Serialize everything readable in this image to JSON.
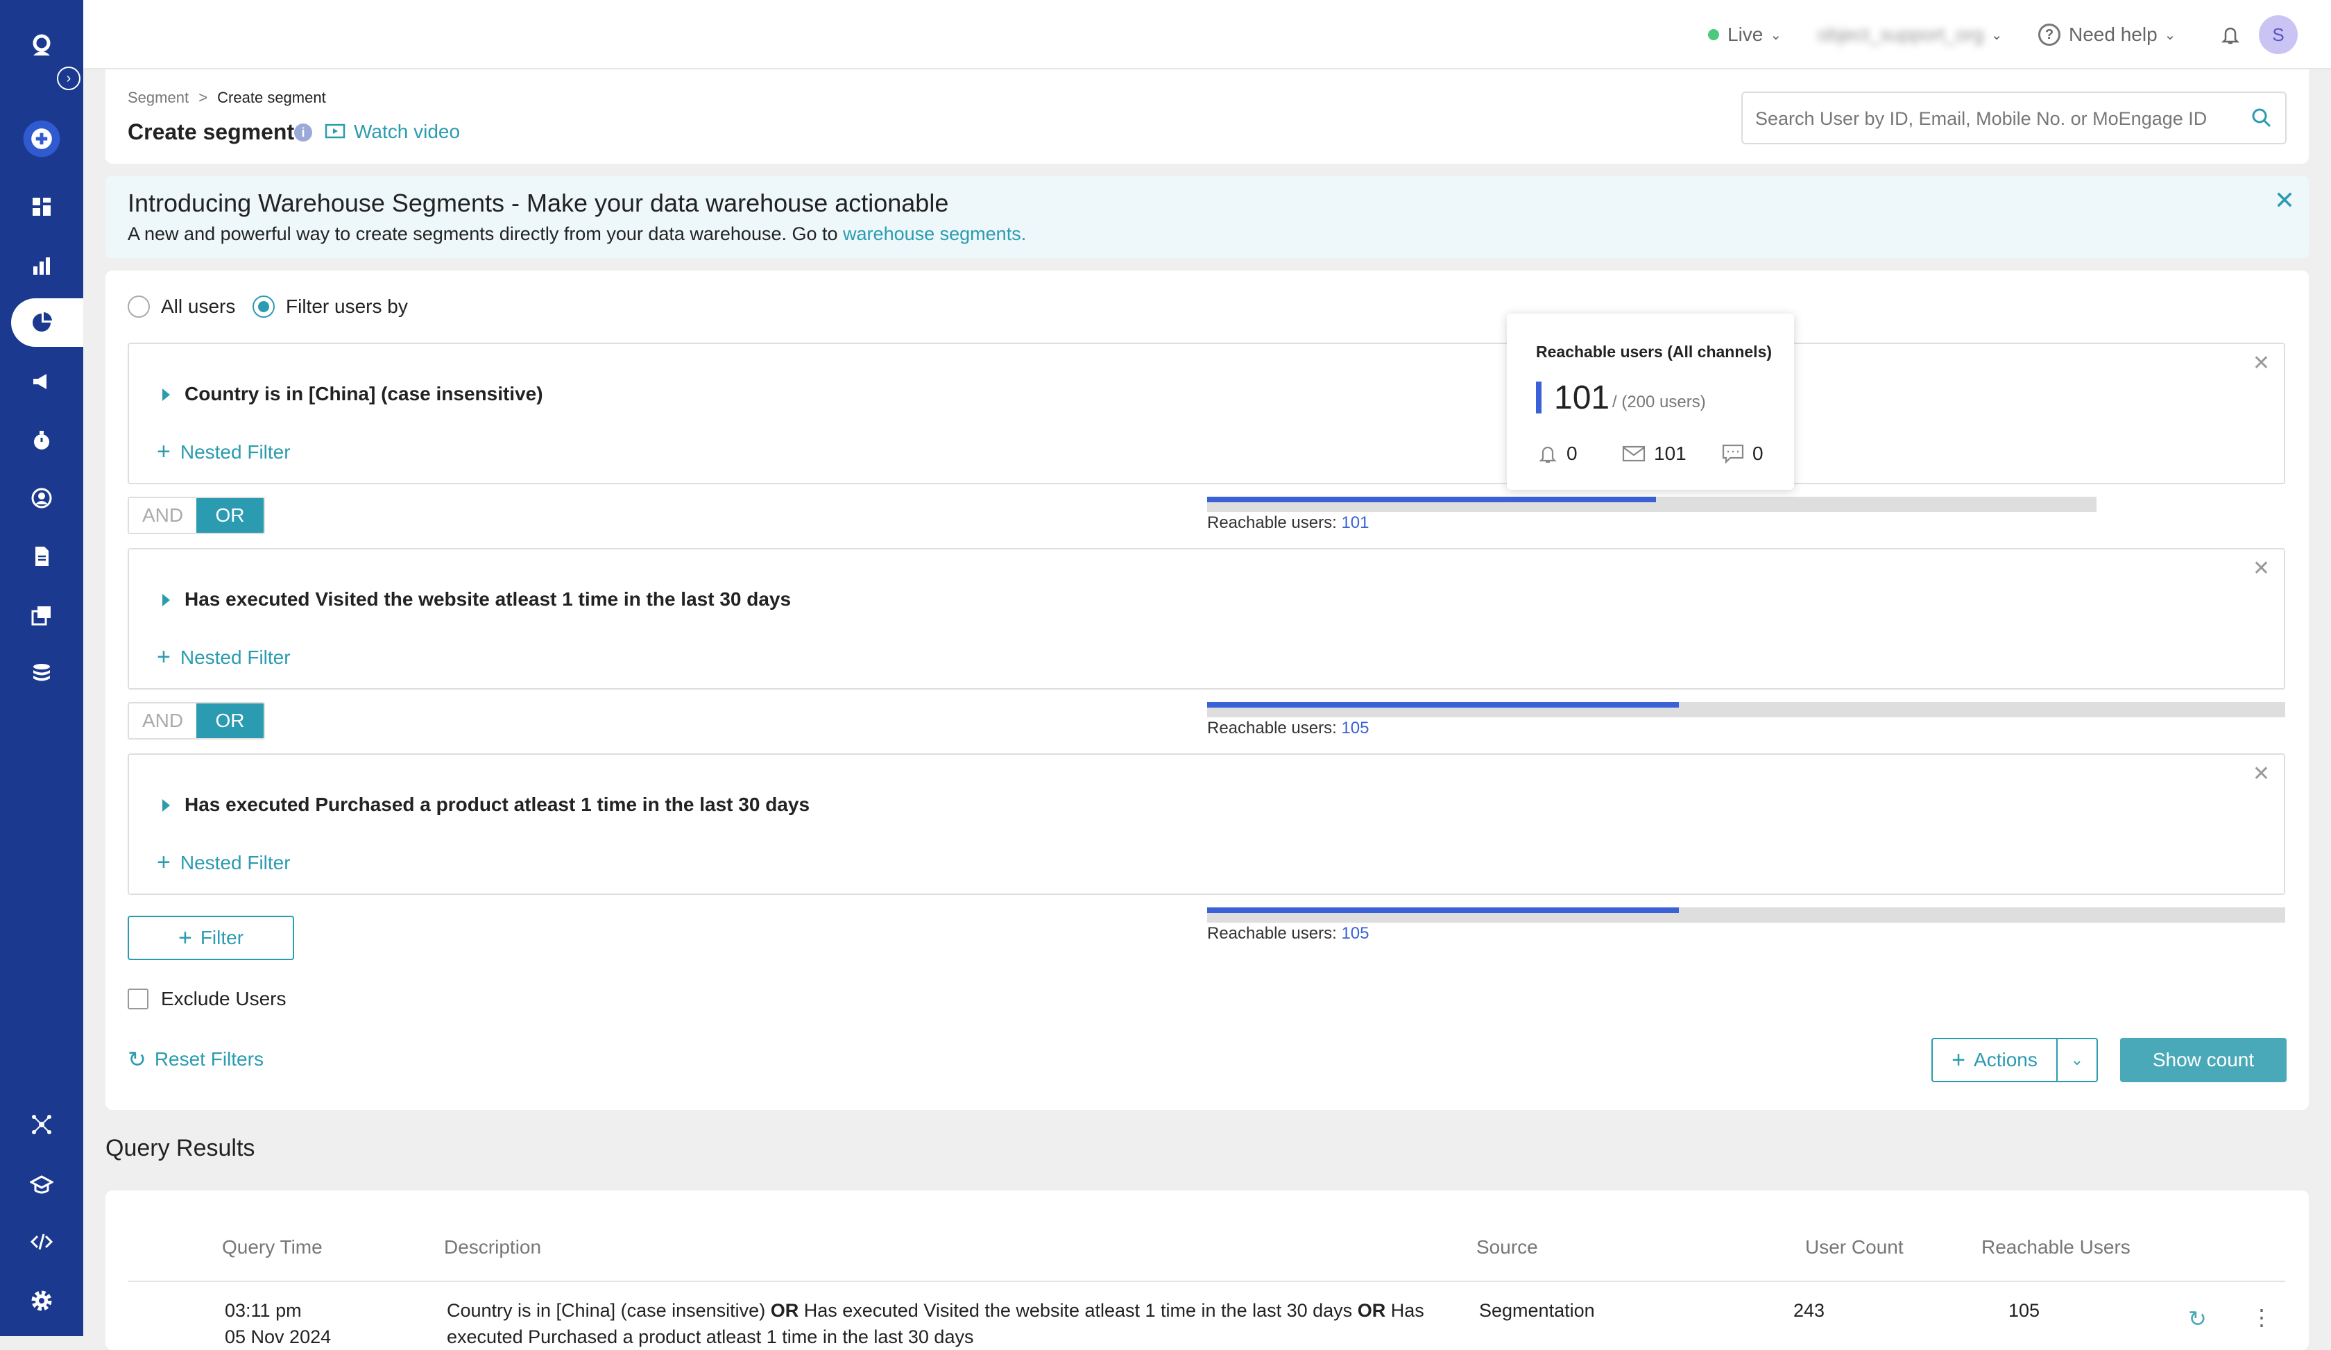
{
  "topbar": {
    "env_label": "Live",
    "workspace_label": "object_support_org",
    "help_label": "Need help",
    "avatar_initial": "S"
  },
  "header": {
    "breadcrumb_parent": "Segment",
    "breadcrumb_sep": ">",
    "breadcrumb_current": "Create segment",
    "title": "Create segment",
    "watch_video": "Watch video",
    "search_placeholder": "Search User by ID, Email, Mobile No. or MoEngage ID"
  },
  "banner": {
    "title": "Introducing Warehouse Segments - Make your data warehouse actionable",
    "text": "A new and powerful way to create segments directly from your data warehouse. Go to",
    "link": "warehouse segments."
  },
  "filters": {
    "radio_all": "All users",
    "radio_filter": "Filter users by",
    "items": [
      {
        "title": "Country  is in [China]  (case insensitive)",
        "nested": "Nested Filter",
        "reach_label": "Reachable users:",
        "reach_value": "101",
        "fill": 0.505
      },
      {
        "title": "Has executed Visited the website atleast 1 time in the last 30 days",
        "nested": "Nested Filter",
        "reach_label": "Reachable users:",
        "reach_value": "105",
        "fill": 0.4375
      },
      {
        "title": "Has executed Purchased a product atleast 1 time in the last 30 days",
        "nested": "Nested Filter",
        "reach_label": "Reachable users:",
        "reach_value": "105",
        "fill": 0.4375
      }
    ],
    "and_label": "AND",
    "or_label": "OR",
    "add_filter": "Filter",
    "exclude_users": "Exclude Users",
    "reset_filters": "Reset Filters",
    "actions": "Actions",
    "show_count": "Show count"
  },
  "tooltip": {
    "title": "Reachable users (All channels)",
    "count": "101",
    "total": "/ (200 users)",
    "push": "0",
    "email": "101",
    "sms": "0"
  },
  "results": {
    "title": "Query Results",
    "columns": [
      "Query Time",
      "Description",
      "Source",
      "User Count",
      "Reachable Users"
    ],
    "row": {
      "time": "03:11 pm",
      "date": "05 Nov 2024",
      "desc_1": "Country  is in [China]  (case insensitive)",
      "op_1": "OR",
      "desc_2": "Has executed Visited the website atleast 1 time in the last 30 days",
      "op_2": "OR",
      "desc_3": "Has",
      "desc_4": "executed Purchased a product atleast 1 time in the last 30 days",
      "source": "Segmentation",
      "user_count": "243",
      "reachable": "105"
    }
  },
  "colors": {
    "sidebar": "#1b3a8f",
    "accent": "#2a9bb0",
    "bar": "#3a62d6"
  }
}
